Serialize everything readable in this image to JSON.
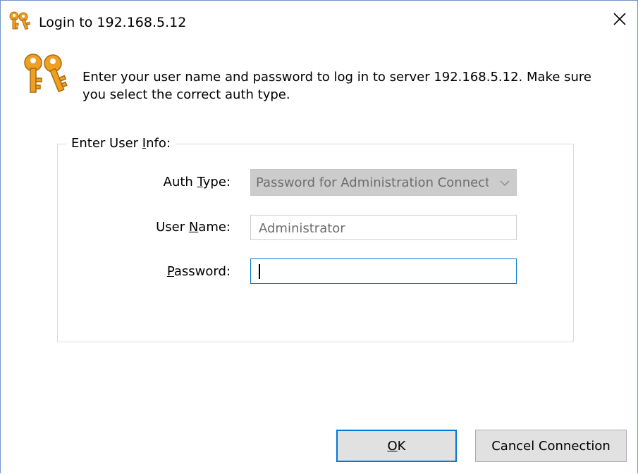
{
  "window": {
    "title": "Login to 192.168.5.12",
    "title_icon": "keys-icon",
    "close_icon": "close-icon"
  },
  "message": {
    "icon": "keys-icon",
    "text": "Enter your user name and password to log in to server 192.168.5.12. Make sure you select the correct auth type."
  },
  "group": {
    "label_pre": "Enter User ",
    "label_key": "I",
    "label_post": "nfo:"
  },
  "fields": {
    "auth_type": {
      "label_pre": "Auth ",
      "label_key": "T",
      "label_post": "ype:",
      "value": "Password for Administration Connection"
    },
    "user_name": {
      "label_pre": "User ",
      "label_key": "N",
      "label_post": "ame:",
      "value": "Administrator"
    },
    "password": {
      "label_pre": "",
      "label_key": "P",
      "label_post": "assword:",
      "value": ""
    }
  },
  "buttons": {
    "ok_key": "O",
    "ok_rest": "K",
    "cancel": "Cancel Connection"
  },
  "colors": {
    "accent": "#0078d7",
    "window_border": "#6e94c8",
    "key_gold": "#f0a020"
  }
}
